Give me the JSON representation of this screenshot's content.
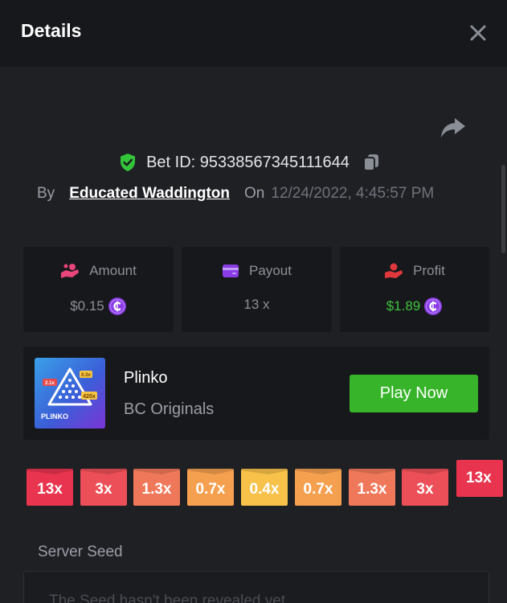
{
  "header": {
    "title": "Details"
  },
  "bet": {
    "id_text": "Bet ID: 95338567345111644",
    "by_label": "By",
    "user": "Educated Waddington",
    "on_label": "On",
    "date": "12/24/2022, 4:45:57 PM"
  },
  "stats": {
    "amount": {
      "label": "Amount",
      "value": "$0.15",
      "icon": "coins-hand-icon"
    },
    "payout": {
      "label": "Payout",
      "value": "13 x",
      "icon": "wallet-icon"
    },
    "profit": {
      "label": "Profit",
      "value": "$1.89",
      "icon": "hand-coin-icon"
    }
  },
  "game": {
    "name": "Plinko",
    "provider": "BC Originals",
    "play_label": "Play Now",
    "thumb_label": "PLINKO",
    "thumb_badges": [
      "2.1x",
      "0.3x",
      "420x"
    ]
  },
  "multipliers": [
    "13x",
    "3x",
    "1.3x",
    "0.7x",
    "0.4x",
    "0.7x",
    "1.3x",
    "3x"
  ],
  "multiplier_last": "13x",
  "seed": {
    "label": "Server Seed",
    "text": "The Seed hasn't been revealed yet"
  },
  "colors": {
    "background": "#1f2024",
    "card": "#17181b",
    "play_button": "#37b42a",
    "profit_green": "#3ec23e",
    "coin_purple": "#8a3de6"
  }
}
